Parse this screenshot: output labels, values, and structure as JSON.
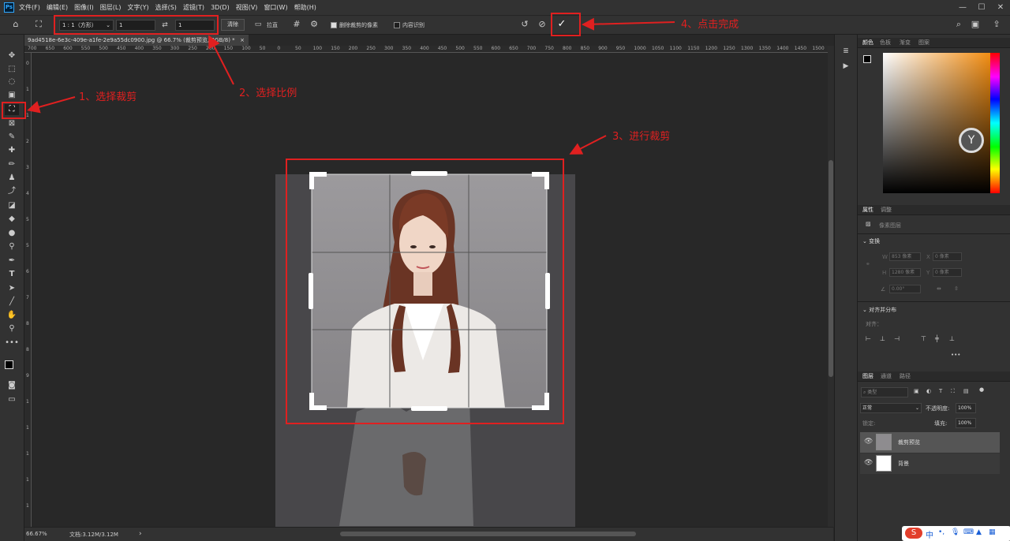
{
  "menu": {
    "logo": "Ps",
    "items": [
      "文件(F)",
      "编辑(E)",
      "图像(I)",
      "图层(L)",
      "文字(Y)",
      "选择(S)",
      "滤镜(T)",
      "3D(D)",
      "视图(V)",
      "窗口(W)",
      "帮助(H)"
    ]
  },
  "options": {
    "ratio_label": "1 : 1（方形）",
    "width_value": "1",
    "height_value": "1",
    "clear_label": "清除",
    "straighten_label": "拉直",
    "delete_cropped_label": "删除裁剪的像素",
    "content_aware_label": "内容识别",
    "commit_glyph": "✓"
  },
  "document": {
    "tab_title": "9ad4518e-6e3c-409e-a1fe-2e9a55dc0900.jpg @ 66.7% (裁剪预览, RGB/8) *"
  },
  "ruler": {
    "top_ticks": [
      "700",
      "650",
      "600",
      "550",
      "500",
      "450",
      "400",
      "350",
      "300",
      "250",
      "200",
      "150",
      "100",
      "50",
      "0",
      "50",
      "100",
      "150",
      "200",
      "250",
      "300",
      "350",
      "400",
      "450",
      "500",
      "550",
      "600",
      "650",
      "700",
      "750",
      "800",
      "850",
      "900",
      "950",
      "1000",
      "1050",
      "1100",
      "1150",
      "1200",
      "1250",
      "1300",
      "1350",
      "1400",
      "1450",
      "1500",
      "15"
    ],
    "left_ticks": [
      "0",
      "1",
      "1",
      "2",
      "3",
      "4",
      "5",
      "5",
      "6",
      "7",
      "8",
      "8",
      "9",
      "1",
      "1",
      "1",
      "1",
      "1"
    ]
  },
  "annotations": {
    "step1": "1、选择裁剪",
    "step2": "2、选择比例",
    "step3": "3、进行裁剪",
    "step4": "4、点击完成"
  },
  "status": {
    "zoom": "66.67%",
    "doc_size": "文档:3.12M/3.12M",
    "arrow": "›"
  },
  "color_panel": {
    "tabs": [
      "颜色",
      "色板",
      "渐变",
      "图案"
    ],
    "hue": "#f28a0c"
  },
  "properties": {
    "tabs": [
      "属性",
      "调整"
    ],
    "layer_type": "像素图层",
    "transform_title": "变换",
    "w": "853 像素",
    "x": "0 像素",
    "h": "1280 像素",
    "y": "0 像素",
    "angle": "0.00°",
    "align_title": "对齐并分布",
    "align_sub": "对齐：",
    "more": "•••"
  },
  "layers": {
    "tabs": [
      "图层",
      "通道",
      "路径"
    ],
    "kind_placeholder": "类型",
    "blend_mode": "正常",
    "opacity_label": "不透明度:",
    "opacity_value": "100%",
    "lock_label": "锁定:",
    "fill_label": "填充:",
    "fill_value": "100%",
    "items": [
      {
        "name": "裁剪预览"
      },
      {
        "name": "背景"
      }
    ]
  },
  "ime": {
    "label": "中"
  }
}
